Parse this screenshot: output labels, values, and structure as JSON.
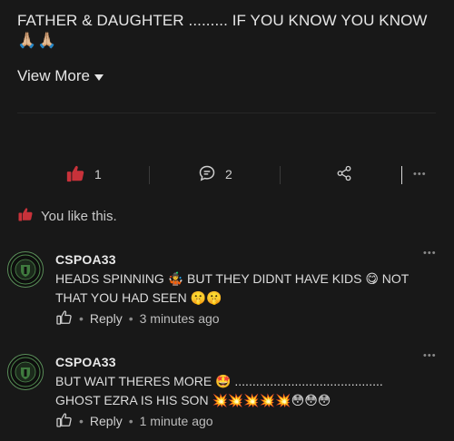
{
  "post": {
    "text": "FATHER & DAUGHTER ......... IF YOU KNOW YOU KNOW",
    "emoji": "🙏🏼🙏🏼",
    "view_more": "View More"
  },
  "actions": {
    "like_count": "1",
    "comment_count": "2"
  },
  "liked_text": "You like this.",
  "comments": [
    {
      "user": "CSPOA33",
      "text_line1": "HEADS SPINNING 🤹 BUT THEY DIDNT HAVE KIDS 😋 NOT",
      "text_line2": "THAT YOU HAD SEEN 🤫🤫",
      "reply": "Reply",
      "time": "3 minutes ago"
    },
    {
      "user": "CSPOA33",
      "text_line1": "BUT WAIT THERES MORE 🤩 ..........................................",
      "text_line2": "GHOST EZRA IS HIS SON 💥💥💥💥💥😳😳😳",
      "reply": "Reply",
      "time": "1 minute ago"
    }
  ],
  "colors": {
    "background": "#181818",
    "like_accent": "#c8323a",
    "text": "#e6e6e6",
    "avatar_ring": "#5b8f5a"
  }
}
